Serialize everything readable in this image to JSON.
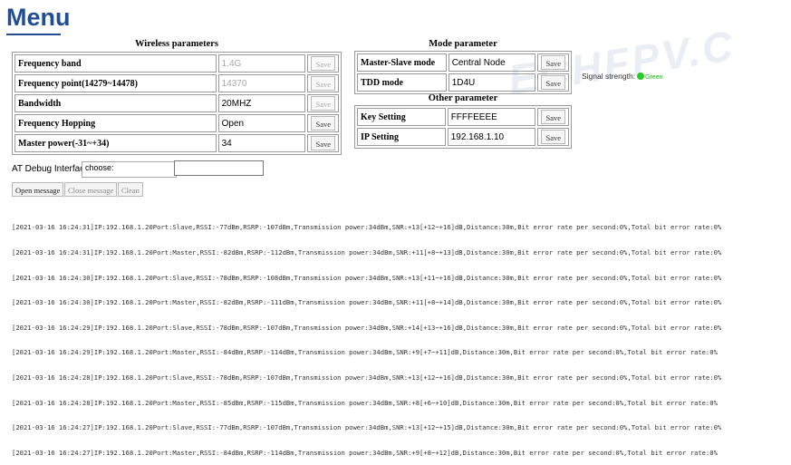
{
  "title": "Menu",
  "watermark": "ECHFPV.C",
  "wireless": {
    "heading": "Wireless parameters",
    "rows": [
      {
        "label": "Frequency band",
        "value": "1.4G",
        "button": "Save",
        "disabled": true
      },
      {
        "label": "Frequency point(14279~14478)",
        "value": "14370",
        "button": "Save",
        "disabled": true
      },
      {
        "label": "Bandwidth",
        "value": "20MHZ",
        "button": "Save",
        "disabled": true
      },
      {
        "label": "Frequency Hopping",
        "value": "Open",
        "button": "Save",
        "disabled": false
      },
      {
        "label": "Master power(-31~+34)",
        "value": "34",
        "button": "Save",
        "disabled": false
      }
    ]
  },
  "mode": {
    "heading": "Mode parameter",
    "rows": [
      {
        "label": "Master-Slave mode",
        "value": "Central Node",
        "button": "Save"
      },
      {
        "label": "TDD mode",
        "value": "1D4U",
        "button": "Save"
      }
    ]
  },
  "other": {
    "heading": "Other parameter",
    "rows": [
      {
        "label": "Key Setting",
        "value": "FFFFEEEE",
        "button": "Save"
      },
      {
        "label": "IP Setting",
        "value": "192.168.1.10",
        "button": "Save"
      }
    ]
  },
  "signal": {
    "label": "Signal strength:",
    "status": "Green",
    "color": "#22cc22"
  },
  "at_debug": {
    "label": "AT Debug Interface",
    "select_value": "choose:",
    "input_value": "",
    "open_button": "Open message",
    "close_button": "Close message",
    "clean_button": "Clean"
  },
  "log": [
    "[2021-03-16 16:24:31]IP:192.168.1.20Port:Slave,RSSI:-77dBm,RSRP:-107dBm,Transmission power:34dBm,SNR:+13[+12~+16]dB,Distance:30m,Bit error rate per second:0%,Total bit error rate:0%",
    "[2021-03-16 16:24:31]IP:192.168.1.20Port:Master,RSSI:-82dBm,RSRP:-112dBm,Transmission power:34dBm,SNR:+11[+8~+13]dB,Distance:30m,Bit error rate per second:0%,Total bit error rate:0%",
    "[2021-03-16 16:24:30]IP:192.168.1.20Port:Slave,RSSI:-78dBm,RSRP:-108dBm,Transmission power:34dBm,SNR:+13[+11~+16]dB,Distance:30m,Bit error rate per second:0%,Total bit error rate:0%",
    "[2021-03-16 16:24:30]IP:192.168.1.20Port:Master,RSSI:-82dBm,RSRP:-111dBm,Transmission power:34dBm,SNR:+11[+8~+14]dB,Distance:30m,Bit error rate per second:0%,Total bit error rate:0%",
    "[2021-03-16 16:24:29]IP:192.168.1.20Port:Slave,RSSI:-78dBm,RSRP:-107dBm,Transmission power:34dBm,SNR:+14[+13~+16]dB,Distance:30m,Bit error rate per second:0%,Total bit error rate:0%",
    "[2021-03-16 16:24:29]IP:192.168.1.20Port:Master,RSSI:-84dBm,RSRP:-114dBm,Transmission power:34dBm,SNR:+9[+7~+11]dB,Distance:30m,Bit error rate per second:0%,Total bit error rate:0%",
    "[2021-03-16 16:24:28]IP:192.168.1.20Port:Slave,RSSI:-78dBm,RSRP:-107dBm,Transmission power:34dBm,SNR:+13[+12~+16]dB,Distance:30m,Bit error rate per second:0%,Total bit error rate:0%",
    "[2021-03-16 16:24:28]IP:192.168.1.20Port:Master,RSSI:-85dBm,RSRP:-115dBm,Transmission power:34dBm,SNR:+8[+6~+10]dB,Distance:30m,Bit error rate per second:0%,Total bit error rate:0%",
    "[2021-03-16 16:24:27]IP:192.168.1.20Port:Slave,RSSI:-77dBm,RSRP:-107dBm,Transmission power:34dBm,SNR:+13[+12~+15]dB,Distance:30m,Bit error rate per second:0%,Total bit error rate:0%",
    "[2021-03-16 16:24:27]IP:192.168.1.20Port:Master,RSSI:-84dBm,RSRP:-114dBm,Transmission power:34dBm,SNR:+9[+8~+12]dB,Distance:30m,Bit error rate per second:0%,Total bit error rate:0%"
  ]
}
